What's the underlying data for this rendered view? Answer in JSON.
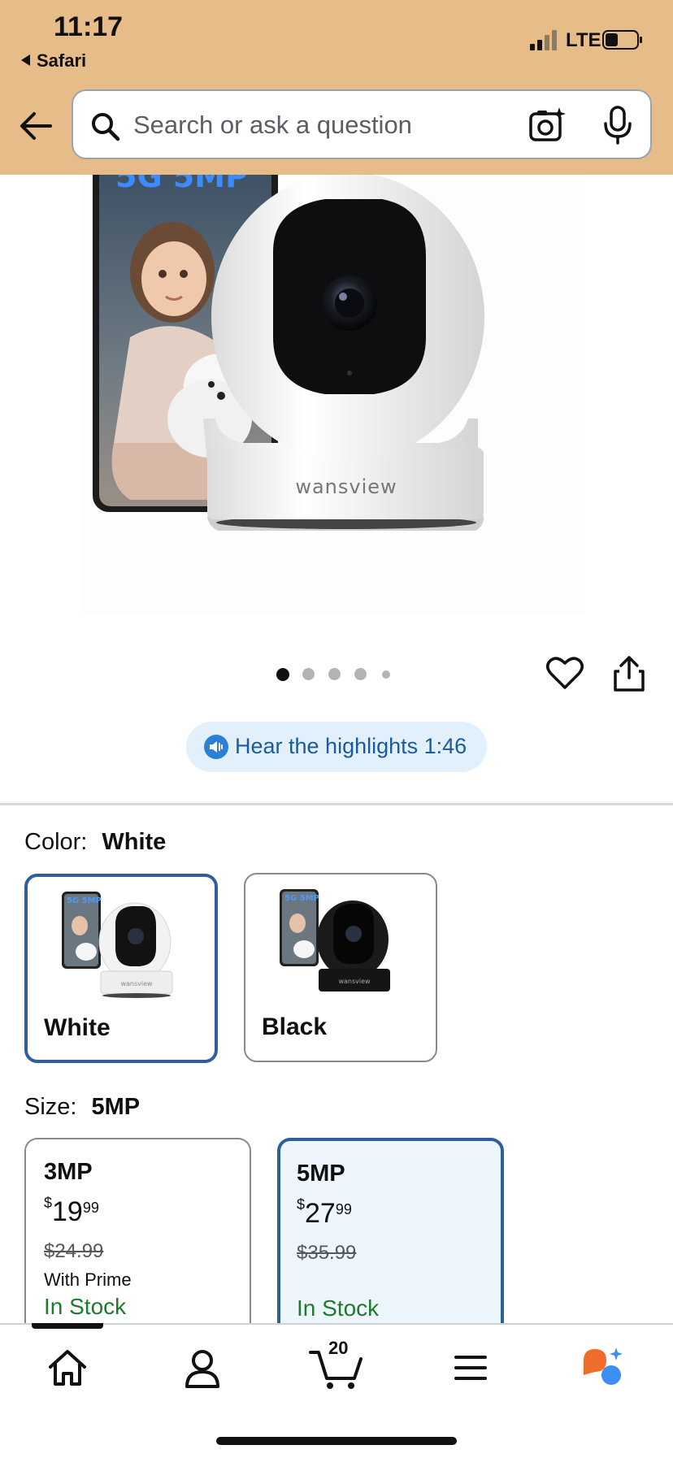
{
  "status_bar": {
    "time": "11:17",
    "back_app": "Safari",
    "network": "LTE"
  },
  "search": {
    "placeholder": "Search or ask a question",
    "value": ""
  },
  "hero": {
    "phone_caption": "5G 5MP",
    "brand": "wansview",
    "image_index": 1,
    "image_count": 5
  },
  "highlights": {
    "label": "Hear the highlights 1:46"
  },
  "color": {
    "label": "Color:",
    "selected": "White",
    "options": [
      {
        "label": "White",
        "selected": true,
        "badge": "5G 5MP"
      },
      {
        "label": "Black",
        "selected": false,
        "badge": "5G 5MP"
      }
    ]
  },
  "size": {
    "label": "Size:",
    "selected": "5MP",
    "options": [
      {
        "name": "3MP",
        "price_currency": "$",
        "price_whole": "19",
        "price_cents": "99",
        "list_price": "$24.99",
        "prime_note": "With Prime",
        "stock": "In Stock",
        "selected": false
      },
      {
        "name": "5MP",
        "price_currency": "$",
        "price_whole": "27",
        "price_cents": "99",
        "list_price": "$35.99",
        "prime_note": "",
        "stock": "In Stock",
        "selected": true
      }
    ]
  },
  "bottom_nav": {
    "cart_count": "20",
    "active_tab": "home"
  },
  "colors": {
    "header_bg": "#e6bd89",
    "link_blue": "#1b5a9c",
    "selected_border": "#2f5f9a",
    "in_stock": "#1f7a2a",
    "rufus_orange": "#ef6c2a",
    "rufus_blue": "#3d8ef0"
  }
}
